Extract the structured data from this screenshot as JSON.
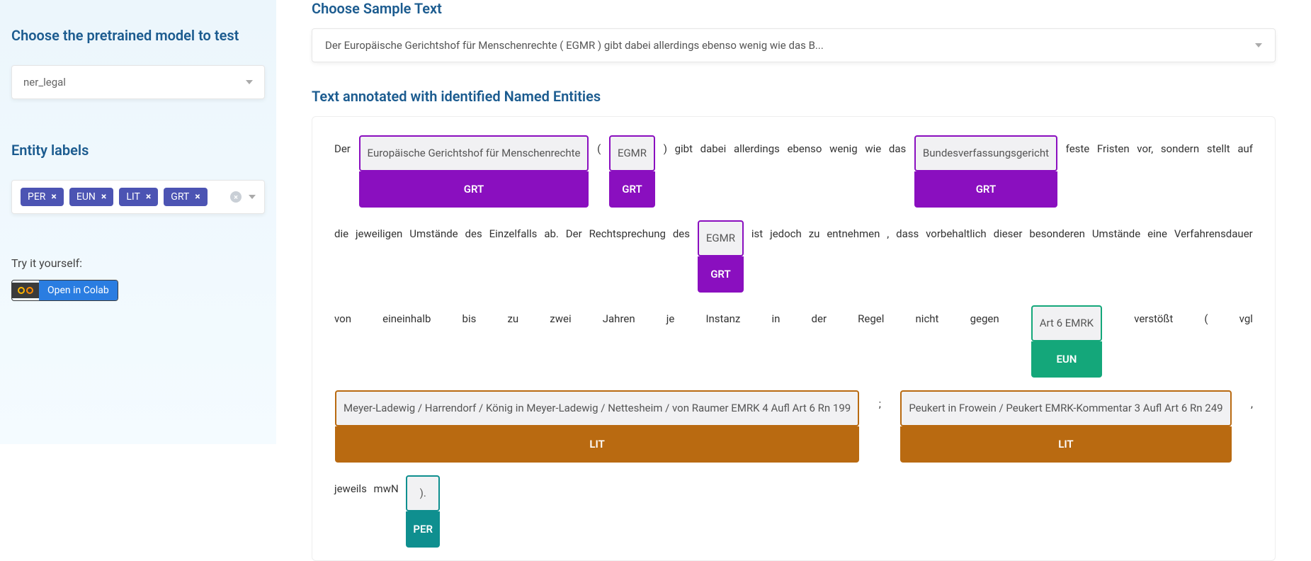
{
  "sidebar": {
    "model_heading": "Choose the pretrained model to test",
    "model_value": "ner_legal",
    "entity_heading": "Entity labels",
    "tags": [
      "PER",
      "EUN",
      "LIT",
      "GRT"
    ],
    "try_label": "Try it yourself:",
    "colab_label": "Open in Colab"
  },
  "main": {
    "sample_heading": "Choose Sample Text",
    "sample_value": "Der Europäische Gerichtshof für Menschenrechte ( EGMR ) gibt dabei allerdings ebenso wenig wie das B...",
    "ann_heading": "Text annotated with identified Named Entities",
    "tokens": [
      {
        "t": "text",
        "v": "Der"
      },
      {
        "t": "ent",
        "label": "GRT",
        "v": "Europäische Gerichtshof für Menschenrechte"
      },
      {
        "t": "text",
        "v": "("
      },
      {
        "t": "ent",
        "label": "GRT",
        "v": "EGMR"
      },
      {
        "t": "text",
        "v": ") gibt dabei allerdings ebenso wenig wie das"
      },
      {
        "t": "ent",
        "label": "GRT",
        "v": "Bundesverfassungsgericht"
      },
      {
        "t": "text",
        "v": "feste"
      },
      {
        "t": "text",
        "v": "Fristen vor, sondern stellt auf die jeweiligen Umstände des Einzelfalls ab. Der Rechtsprechung des"
      },
      {
        "t": "ent",
        "label": "GRT",
        "v": "EGMR"
      },
      {
        "t": "text",
        "v": "ist jedoch zu entnehmen , dass"
      },
      {
        "t": "text",
        "v": "vorbehaltlich dieser besonderen Umstände eine Verfahrensdauer von eineinhalb bis zu zwei Jahren je Instanz in der Regel nicht gegen"
      },
      {
        "t": "ent",
        "label": "EUN",
        "v": "Art 6 EMRK"
      },
      {
        "t": "text",
        "v": "verstößt ( vgl"
      },
      {
        "t": "ent",
        "label": "LIT",
        "v": "Meyer-Ladewig / Harrendorf / König in Meyer-Ladewig / Nettesheim / von Raumer EMRK 4 Aufl Art 6 Rn 199"
      },
      {
        "t": "text",
        "v": ";"
      },
      {
        "t": "ent",
        "label": "LIT",
        "v": "Peukert in Frowein / Peukert EMRK-Kommentar 3 Aufl Art 6 Rn 249"
      },
      {
        "t": "text",
        "v": ", jeweils mwN"
      },
      {
        "t": "ent",
        "label": "PER",
        "v": ")."
      }
    ]
  }
}
